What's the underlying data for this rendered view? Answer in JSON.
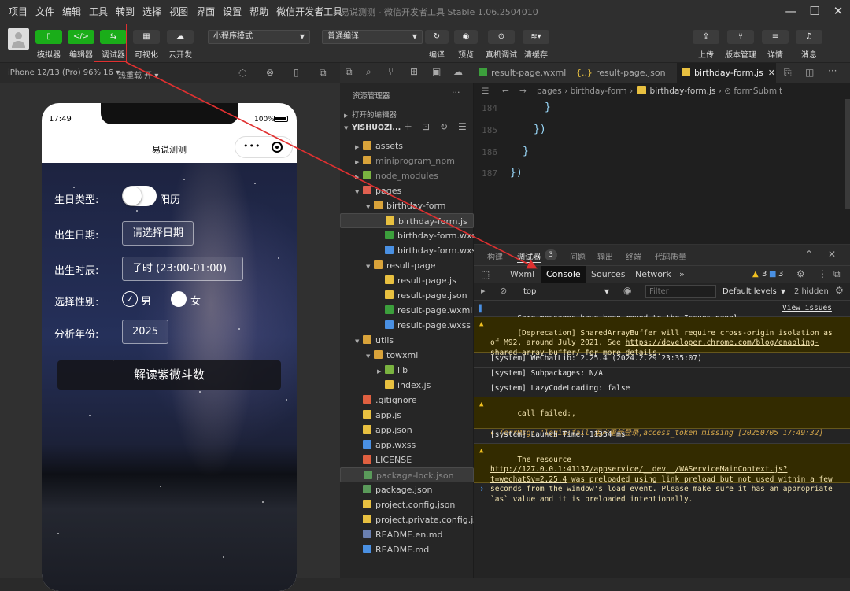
{
  "menu": [
    "项目",
    "文件",
    "编辑",
    "工具",
    "转到",
    "选择",
    "视图",
    "界面",
    "设置",
    "帮助",
    "微信开发者工具"
  ],
  "window_title": "易说测测 - 微信开发者工具 Stable 1.06.2504010",
  "toolbar": {
    "buttons": [
      {
        "label": "模拟器",
        "glyph": "▯"
      },
      {
        "label": "编辑器",
        "glyph": "</>"
      },
      {
        "label": "调试器",
        "glyph": "⇆"
      },
      {
        "label": "可视化",
        "glyph": "▦"
      },
      {
        "label": "云开发",
        "glyph": "☁"
      }
    ],
    "mode_select": "小程序模式",
    "compile_select": "普通编译",
    "mid_buttons": [
      "编译",
      "预览",
      "真机调试",
      "清缓存"
    ],
    "right_buttons": [
      "上传",
      "版本管理",
      "详情",
      "消息"
    ]
  },
  "simulator": {
    "device": "iPhone 12/13 (Pro) 96% 16 ▾",
    "hot_reload": "热重载 开 ▾",
    "time": "17:49",
    "battery": "100%",
    "page_title": "易说测测",
    "form": {
      "birthday_type_label": "生日类型:",
      "birthday_type_value": "阳历",
      "birth_date_label": "出生日期:",
      "birth_date_value": "请选择日期",
      "birth_hour_label": "出生时辰:",
      "birth_hour_value": "子时 (23:00-01:00)",
      "gender_label": "选择性别:",
      "gender_male": "男",
      "gender_female": "女",
      "year_label": "分析年份:",
      "year_value": "2025",
      "submit": "解读紫微斗数"
    }
  },
  "explorer": {
    "title": "资源管理器",
    "open_editors": "打开的编辑器",
    "project": "YISHUOZI...",
    "tree": [
      {
        "name": "assets",
        "type": "folder",
        "depth": 1,
        "open": false
      },
      {
        "name": "miniprogram_npm",
        "type": "folder",
        "depth": 1,
        "open": false,
        "dim": true
      },
      {
        "name": "node_modules",
        "type": "folder-green",
        "depth": 1,
        "open": false,
        "dim": true
      },
      {
        "name": "pages",
        "type": "folder-red",
        "depth": 1,
        "open": true
      },
      {
        "name": "birthday-form",
        "type": "folder",
        "depth": 2,
        "open": true
      },
      {
        "name": "birthday-form.js",
        "type": "js",
        "depth": 3,
        "selected": true
      },
      {
        "name": "birthday-form.wxml",
        "type": "wxml",
        "depth": 3
      },
      {
        "name": "birthday-form.wxss",
        "type": "wxss",
        "depth": 3
      },
      {
        "name": "result-page",
        "type": "folder",
        "depth": 2,
        "open": true
      },
      {
        "name": "result-page.js",
        "type": "js",
        "depth": 3
      },
      {
        "name": "result-page.json",
        "type": "json",
        "depth": 3
      },
      {
        "name": "result-page.wxml",
        "type": "wxml",
        "depth": 3
      },
      {
        "name": "result-page.wxss",
        "type": "wxss",
        "depth": 3
      },
      {
        "name": "utils",
        "type": "folder",
        "depth": 1,
        "open": true
      },
      {
        "name": "towxml",
        "type": "folder",
        "depth": 2,
        "open": true
      },
      {
        "name": "lib",
        "type": "folder-green",
        "depth": 3,
        "open": false
      },
      {
        "name": "index.js",
        "type": "js",
        "depth": 3
      },
      {
        "name": ".gitignore",
        "type": "git",
        "depth": 1
      },
      {
        "name": "app.js",
        "type": "js",
        "depth": 1
      },
      {
        "name": "app.json",
        "type": "json",
        "depth": 1
      },
      {
        "name": "app.wxss",
        "type": "wxss",
        "depth": 1
      },
      {
        "name": "LICENSE",
        "type": "license",
        "depth": 1
      },
      {
        "name": "package-lock.json",
        "type": "npm",
        "depth": 1,
        "dim": true,
        "selected": true
      },
      {
        "name": "package.json",
        "type": "npm",
        "depth": 1
      },
      {
        "name": "project.config.json",
        "type": "json",
        "depth": 1
      },
      {
        "name": "project.private.config.js...",
        "type": "json",
        "depth": 1
      },
      {
        "name": "README.en.md",
        "type": "md",
        "depth": 1
      },
      {
        "name": "README.md",
        "type": "info",
        "depth": 1
      }
    ]
  },
  "editor": {
    "tabs": [
      {
        "name": "result-page.wxml",
        "type": "wxml"
      },
      {
        "name": "result-page.json",
        "type": "json"
      },
      {
        "name": "birthday-form.js",
        "type": "js",
        "active": true
      }
    ],
    "breadcrumb": [
      "pages",
      "birthday-form",
      "birthday-form.js",
      "formSubmit"
    ],
    "lines": [
      {
        "no": "184",
        "text": "}",
        "indent": 90
      },
      {
        "no": "185",
        "text": "})",
        "indent": 76
      },
      {
        "no": "186",
        "text": "}",
        "indent": 62
      },
      {
        "no": "187",
        "text": "})",
        "indent": 46
      }
    ]
  },
  "debugger": {
    "panel_tabs": [
      "构建",
      "调试器",
      "问题",
      "输出",
      "终端",
      "代码质量"
    ],
    "debugger_badge": "3",
    "dev_tabs": [
      "Wxml",
      "Console",
      "Sources",
      "Network"
    ],
    "more": "»",
    "warn_count": "3",
    "info_count": "3",
    "context": "top",
    "filter_placeholder": "Filter",
    "levels": "Default levels",
    "hidden": "2 hidden",
    "messages": [
      {
        "kind": "info",
        "text": "Some messages have been moved to the Issues panel.",
        "link": "View issues"
      },
      {
        "kind": "warn",
        "text": "[Deprecation] SharedArrayBuffer will require cross-origin isolation as of M92, around July 2021. See ",
        "link": "https://developer.chrome.com/blog/enabling-shared-array-buffer/",
        "tail": " for more details."
      },
      {
        "kind": "log",
        "text": "[system] WeChatLib: 2.25.4 (2024.2.29 23:35:07)"
      },
      {
        "kind": "log",
        "text": "[system] Subpackages: N/A"
      },
      {
        "kind": "log",
        "text": "[system] LazyCodeLoading: false"
      },
      {
        "kind": "warn",
        "text": "call failed:,",
        "sub": "▸ {errMsg: \"login:fail 用户重新登录,access_token missing [20250705 17:49:32]"
      },
      {
        "kind": "log",
        "text": "[system] Launch Time: 11334 ms"
      },
      {
        "kind": "warn",
        "text": "The resource ",
        "link": "http://127.0.0.1:41137/appservice/__dev__/WAServiceMainContext.js?t=wechat&v=2.25.4",
        "tail": " was preloaded using link preload but not used within a few seconds from the window's load event. Please make sure it has an appropriate `as` value and it is preloaded intentionally."
      }
    ],
    "prompt": "›"
  },
  "colors": {
    "accent_green": "#1aad19",
    "highlight_red": "#e03030",
    "warn_bg": "#332b00"
  }
}
